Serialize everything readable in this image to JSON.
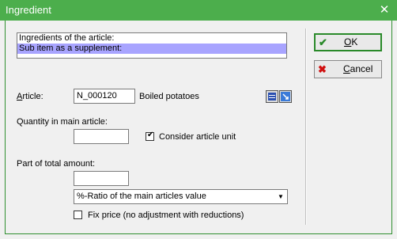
{
  "window": {
    "title": "Ingredient",
    "close_glyph": "✕"
  },
  "listbox": {
    "items": [
      "Ingredients of the article:",
      "Sub item as a supplement:"
    ],
    "selected_index": 1
  },
  "article": {
    "label": "Article:",
    "code": "N_000120",
    "name": "Boiled potatoes"
  },
  "quantity": {
    "label": "Quantity in main article:",
    "value": "",
    "consider_unit_label": "Consider article unit",
    "consider_unit_checked": true
  },
  "part": {
    "label": "Part of total amount:",
    "value": "",
    "ratio_option": "%-Ratio of the main articles value",
    "fix_price_label": "Fix price (no adjustment with reductions)",
    "fix_price_checked": false
  },
  "buttons": {
    "ok_label": "OK",
    "cancel_label": "Cancel"
  },
  "colors": {
    "titlebar": "#4cae4c",
    "selection": "#a8a4ff",
    "ok_icon": "#2a8a2a",
    "cancel_icon": "#d01010"
  },
  "icons": {
    "ok": "check-icon",
    "cancel": "x-icon",
    "close": "close-icon"
  }
}
